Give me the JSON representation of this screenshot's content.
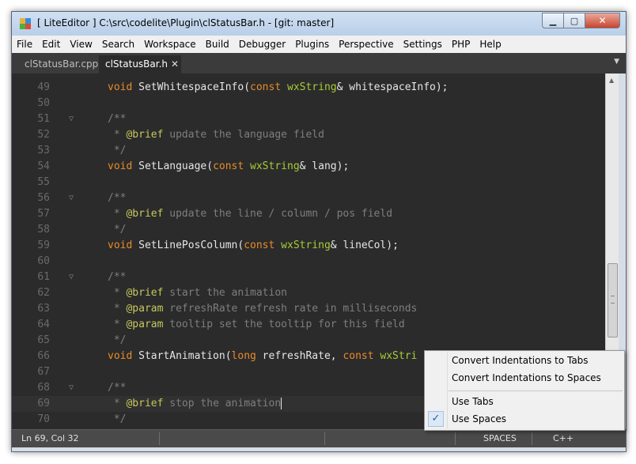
{
  "window": {
    "title": "[ LiteEditor ] C:\\src\\codelite\\Plugin\\clStatusBar.h - [git: master]",
    "controls": {
      "minimize": "▁",
      "maximize": "▢",
      "close": "✕"
    }
  },
  "menubar": {
    "items": [
      "File",
      "Edit",
      "View",
      "Search",
      "Workspace",
      "Build",
      "Debugger",
      "Plugins",
      "Perspective",
      "Settings",
      "PHP",
      "Help"
    ]
  },
  "tabs": [
    {
      "label": "clStatusBar.cpp",
      "active": false
    },
    {
      "label": "clStatusBar.h",
      "active": true,
      "close": "✕"
    }
  ],
  "tab_dropdown": "▼",
  "editor": {
    "colors": {
      "background": "#2b2b2b",
      "keyword": "#e98b2a",
      "type": "#a6cc36",
      "comment": "#7e7e7e",
      "doc_tag": "#c7c75e",
      "text": "#e6e6e6"
    },
    "lines": [
      {
        "num": "49",
        "fold": "",
        "text": "    void SetWhitespaceInfo(const wxString& whitespaceInfo);"
      },
      {
        "num": "50",
        "fold": "",
        "text": ""
      },
      {
        "num": "51",
        "fold": "▽",
        "text": "    /**"
      },
      {
        "num": "52",
        "fold": "",
        "text": "     * @brief update the language field"
      },
      {
        "num": "53",
        "fold": "",
        "text": "     */"
      },
      {
        "num": "54",
        "fold": "",
        "text": "    void SetLanguage(const wxString& lang);"
      },
      {
        "num": "55",
        "fold": "",
        "text": ""
      },
      {
        "num": "56",
        "fold": "▽",
        "text": "    /**"
      },
      {
        "num": "57",
        "fold": "",
        "text": "     * @brief update the line / column / pos field"
      },
      {
        "num": "58",
        "fold": "",
        "text": "     */"
      },
      {
        "num": "59",
        "fold": "",
        "text": "    void SetLinePosColumn(const wxString& lineCol);"
      },
      {
        "num": "60",
        "fold": "",
        "text": ""
      },
      {
        "num": "61",
        "fold": "▽",
        "text": "    /**"
      },
      {
        "num": "62",
        "fold": "",
        "text": "     * @brief start the animation"
      },
      {
        "num": "63",
        "fold": "",
        "text": "     * @param refreshRate refresh rate in milliseconds"
      },
      {
        "num": "64",
        "fold": "",
        "text": "     * @param tooltip set the tooltip for this field"
      },
      {
        "num": "65",
        "fold": "",
        "text": "     */"
      },
      {
        "num": "66",
        "fold": "",
        "text": "    void StartAnimation(long refreshRate, const wxStri"
      },
      {
        "num": "67",
        "fold": "",
        "text": ""
      },
      {
        "num": "68",
        "fold": "▽",
        "text": "    /**"
      },
      {
        "num": "69",
        "fold": "",
        "text": "     * @brief stop the animation",
        "current": true
      },
      {
        "num": "70",
        "fold": "",
        "text": "     */"
      }
    ]
  },
  "statusbar": {
    "position": "Ln 69, Col 32",
    "indent_mode": "SPACES",
    "language": "C++"
  },
  "context_menu": {
    "items": [
      {
        "label": "Convert Indentations to Tabs",
        "checked": false
      },
      {
        "label": "Convert Indentations to Spaces",
        "checked": false
      },
      {
        "label": "Use Tabs",
        "checked": false
      },
      {
        "label": "Use Spaces",
        "checked": true,
        "check_mark": "✓"
      }
    ]
  }
}
